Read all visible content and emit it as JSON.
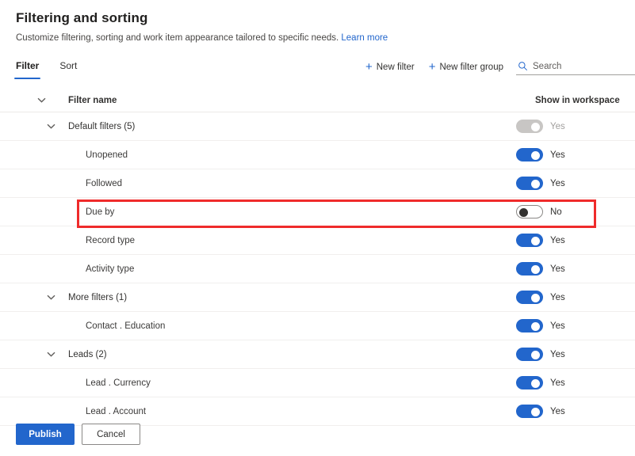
{
  "header": {
    "title": "Filtering and sorting",
    "subtitle": "Customize filtering, sorting and work item appearance tailored to specific needs.",
    "learn_more": "Learn more"
  },
  "tabs": [
    {
      "label": "Filter",
      "active": true
    },
    {
      "label": "Sort",
      "active": false
    }
  ],
  "commands": {
    "new_filter": "New filter",
    "new_filter_group": "New filter group",
    "plus_icon": "plus-icon",
    "search_icon": "search-icon",
    "search_placeholder": "Search",
    "search_value": ""
  },
  "table": {
    "columns": {
      "filter_name": "Filter name",
      "show_in_workspace": "Show in workspace"
    },
    "rows": [
      {
        "label": "Default filters (5)",
        "level": "group",
        "chevron": true,
        "toggle": "on",
        "toggle_label": "Yes",
        "disabled": true,
        "highlighted": false
      },
      {
        "label": "Unopened",
        "level": "child",
        "chevron": false,
        "toggle": "on",
        "toggle_label": "Yes",
        "disabled": false,
        "highlighted": false
      },
      {
        "label": "Followed",
        "level": "child",
        "chevron": false,
        "toggle": "on",
        "toggle_label": "Yes",
        "disabled": false,
        "highlighted": false
      },
      {
        "label": "Due by",
        "level": "child",
        "chevron": false,
        "toggle": "off",
        "toggle_label": "No",
        "disabled": false,
        "highlighted": true
      },
      {
        "label": "Record type",
        "level": "child",
        "chevron": false,
        "toggle": "on",
        "toggle_label": "Yes",
        "disabled": false,
        "highlighted": false
      },
      {
        "label": "Activity type",
        "level": "child",
        "chevron": false,
        "toggle": "on",
        "toggle_label": "Yes",
        "disabled": false,
        "highlighted": false
      },
      {
        "label": "More filters (1)",
        "level": "group",
        "chevron": true,
        "toggle": "on",
        "toggle_label": "Yes",
        "disabled": false,
        "highlighted": false
      },
      {
        "label": "Contact . Education",
        "level": "child",
        "chevron": false,
        "toggle": "on",
        "toggle_label": "Yes",
        "disabled": false,
        "highlighted": false
      },
      {
        "label": "Leads (2)",
        "level": "group",
        "chevron": true,
        "toggle": "on",
        "toggle_label": "Yes",
        "disabled": false,
        "highlighted": false
      },
      {
        "label": "Lead . Currency",
        "level": "child",
        "chevron": false,
        "toggle": "on",
        "toggle_label": "Yes",
        "disabled": false,
        "highlighted": false
      },
      {
        "label": "Lead . Account",
        "level": "child",
        "chevron": false,
        "toggle": "on",
        "toggle_label": "Yes",
        "disabled": false,
        "highlighted": false
      }
    ]
  },
  "footer": {
    "publish": "Publish",
    "cancel": "Cancel"
  },
  "colors": {
    "accent": "#2266cc",
    "highlight": "#ef2b2b",
    "disabled_toggle": "#c8c6c4"
  }
}
